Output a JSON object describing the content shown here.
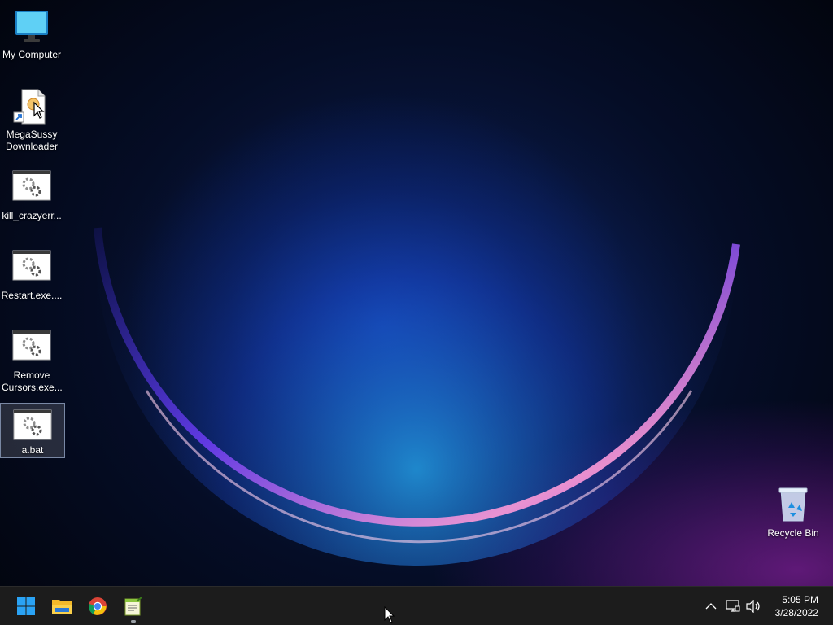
{
  "desktop": {
    "icons": [
      {
        "label": "My Computer",
        "icon": "monitor-icon"
      },
      {
        "label": "MegaSussy Downloader",
        "icon": "shortcut-file-icon"
      },
      {
        "label": "kill_crazyerr...",
        "icon": "executable-gear-icon"
      },
      {
        "label": "Restart.exe....",
        "icon": "executable-gear-icon"
      },
      {
        "label": "Remove Cursors.exe...",
        "icon": "executable-gear-icon"
      },
      {
        "label": "a.bat",
        "icon": "batch-file-gear-icon",
        "selected": true
      }
    ],
    "recycle_bin": {
      "label": "Recycle Bin",
      "icon": "recycle-bin-icon"
    }
  },
  "taskbar": {
    "pinned": [
      {
        "name": "start",
        "icon": "windows-start-icon"
      },
      {
        "name": "file-explorer",
        "icon": "folder-icon"
      },
      {
        "name": "chrome",
        "icon": "chrome-icon"
      },
      {
        "name": "notepad-plus",
        "icon": "notepad-icon",
        "running": true
      }
    ],
    "tray": {
      "icons": [
        "chevron-up-icon",
        "network-icon",
        "volume-icon"
      ],
      "time": "5:05 PM",
      "date": "3/28/2022"
    }
  },
  "colors": {
    "taskbar": "#1c1c1c",
    "accent": "#1e90ff",
    "wallpaper_glow_blue": "#1450dc",
    "wallpaper_glow_purple": "#aa28c8"
  }
}
